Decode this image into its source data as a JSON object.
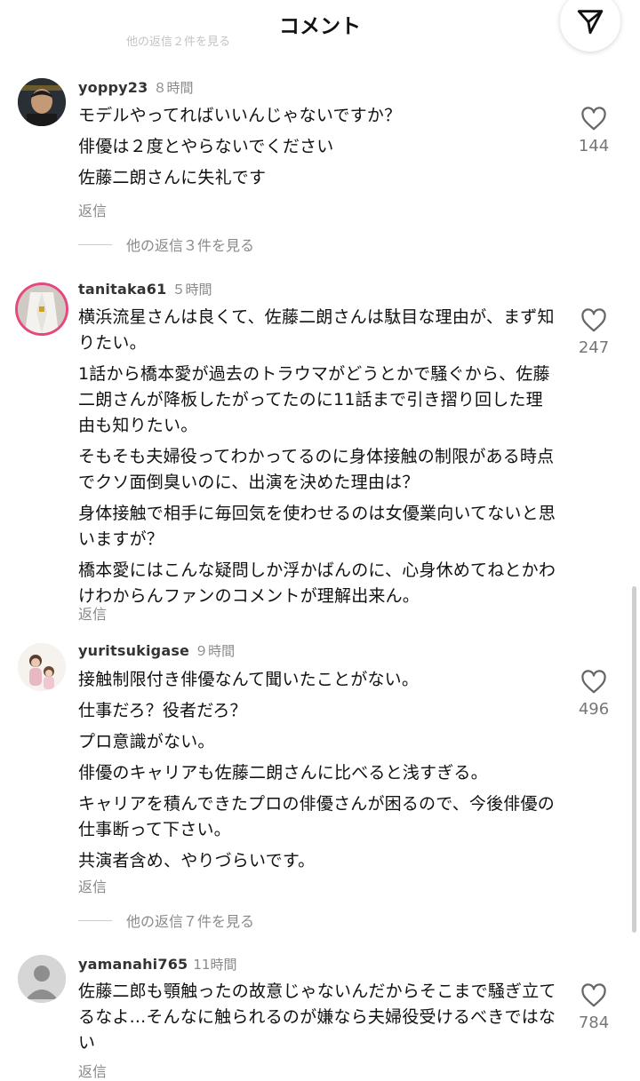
{
  "header": {
    "title": "コメント",
    "faded_more_label": "他の返信２件を見る",
    "share_icon": "send-paper-plane-icon"
  },
  "comments": [
    {
      "username": "yoppy23",
      "time": "８時間",
      "paragraphs": [
        "モデルやってればいいんじゃないですか？",
        "俳優は２度とやらないでください",
        "佐藤二朗さんに失礼です"
      ],
      "reply_label": "返信",
      "likes": "144",
      "more_replies": "他の返信３件を見る"
    },
    {
      "username": "tanitaka61",
      "time": "５時間",
      "paragraphs": [
        "横浜流星さんは良くて、佐藤二朗さんは駄目な理由が、まず知りたい。",
        "1話から橋本愛が過去のトラウマがどうとかで騒ぐから、佐藤二朗さんが降板したがってたのに11話まで引き摺り回した理由も知りたい。",
        "そもそも夫婦役ってわかってるのに身体接触の制限がある時点でクソ面倒臭いのに、出演を決めた理由は？",
        "身体接触で相手に毎回気を使わせるのは女優業向いてないと思いますが？",
        "橋本愛にはこんな疑問しか浮かばんのに、心身休めてねとかわけわからんファンのコメントが理解出来ん。"
      ],
      "reply_label": "返信",
      "likes": "247"
    },
    {
      "username": "yuritsukigase",
      "time": "９時間",
      "paragraphs": [
        "接触制限付き俳優なんて聞いたことがない。",
        "仕事だろ？役者だろ？",
        "プロ意識がない。",
        "俳優のキャリアも佐藤二朗さんに比べると浅すぎる。",
        "キャリアを積んできたプロの俳優さんが困るので、今後俳優の仕事断って下さい。",
        "共演者含め、やりづらいです。"
      ],
      "reply_label": "返信",
      "likes": "496",
      "more_replies": "他の返信７件を見る"
    },
    {
      "username": "yamanahi765",
      "time": "11時間",
      "paragraphs": [
        "佐藤二郎も顎触ったの故意じゃないんだからそこまで騒ぎ立てるなよ...そんなに触られるのが嫌なら夫婦役受けるべきではない"
      ],
      "reply_label": "返信",
      "likes": "784"
    }
  ],
  "icons": {
    "like": "heart-outline-icon",
    "default_avatar": "default-avatar-icon"
  }
}
